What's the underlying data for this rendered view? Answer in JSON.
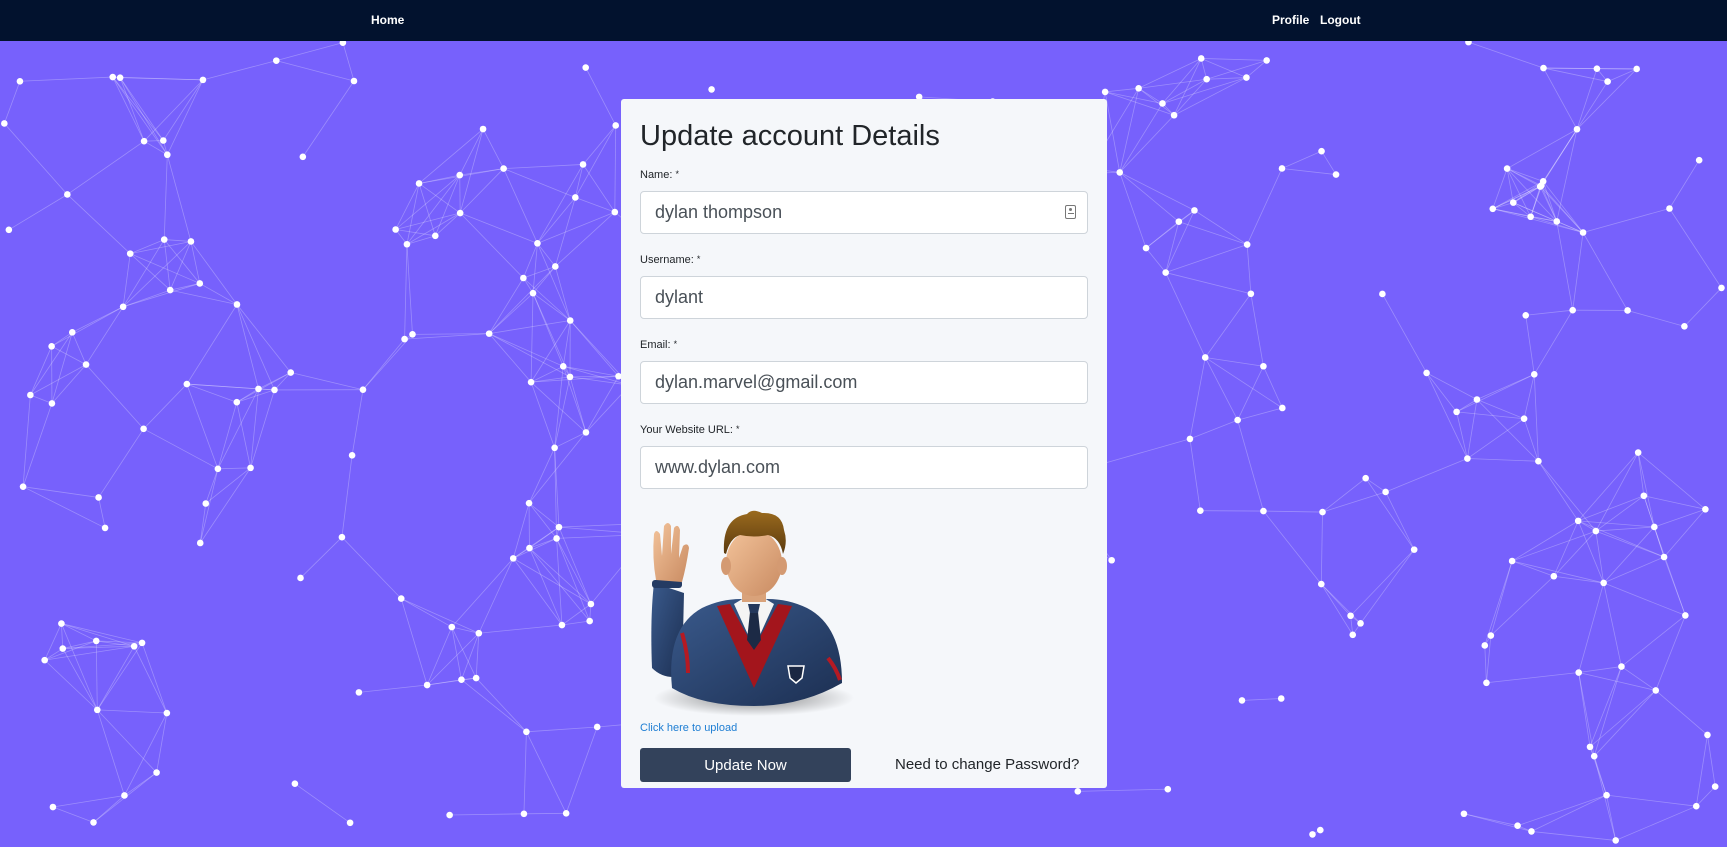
{
  "nav": {
    "home": "Home",
    "profile": "Profile",
    "logout": "Logout"
  },
  "form": {
    "title": "Update account Details",
    "required_mark": "*",
    "fields": {
      "name": {
        "label": "Name:",
        "value": "dylan thompson"
      },
      "username": {
        "label": "Username:",
        "value": "dylant"
      },
      "email": {
        "label": "Email:",
        "value": "dylan.marvel@gmail.com"
      },
      "website": {
        "label": "Your Website URL:",
        "value": "www.dylan.com"
      }
    },
    "upload_link": "Click here to upload",
    "submit_label": "Update Now",
    "password_link": "Need to change Password?"
  },
  "colors": {
    "background": "#7761fc",
    "navbar": "#02122e",
    "button": "#33425b",
    "link": "#1e7ed3"
  },
  "icons": {
    "name_field": "contact-card-icon",
    "avatar": "waving-man-avatar"
  }
}
